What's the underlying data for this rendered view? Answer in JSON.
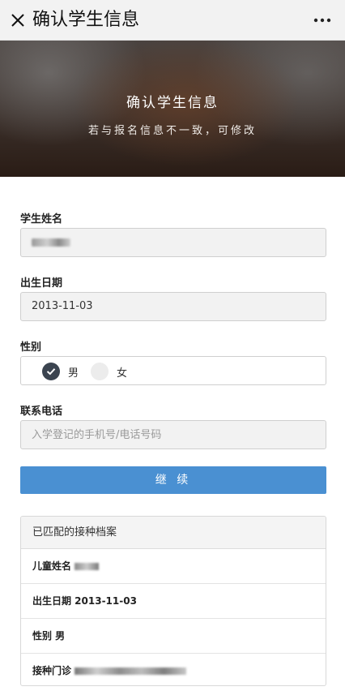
{
  "nav": {
    "title": "确认学生信息",
    "close_icon": "close-icon",
    "more_icon": "more-dots-icon"
  },
  "hero": {
    "title": "确认学生信息",
    "subtitle": "若与报名信息不一致，可修改"
  },
  "form": {
    "name_label": "学生姓名",
    "birth_label": "出生日期",
    "birth_value": "2013-11-03",
    "gender_label": "性别",
    "gender_options": [
      "男",
      "女"
    ],
    "gender_selected": "男",
    "phone_label": "联系电话",
    "phone_placeholder": "入学登记的手机号/电话号码",
    "continue_label": "继 续"
  },
  "record": {
    "header": "已匹配的接种档案",
    "name_label": "儿童姓名",
    "birth_text": "出生日期 2013-11-03",
    "gender_text": "性别 男",
    "clinic_label": "接种门诊"
  },
  "colors": {
    "accent": "#4a90d2",
    "radio_selected": "#3b4450"
  }
}
